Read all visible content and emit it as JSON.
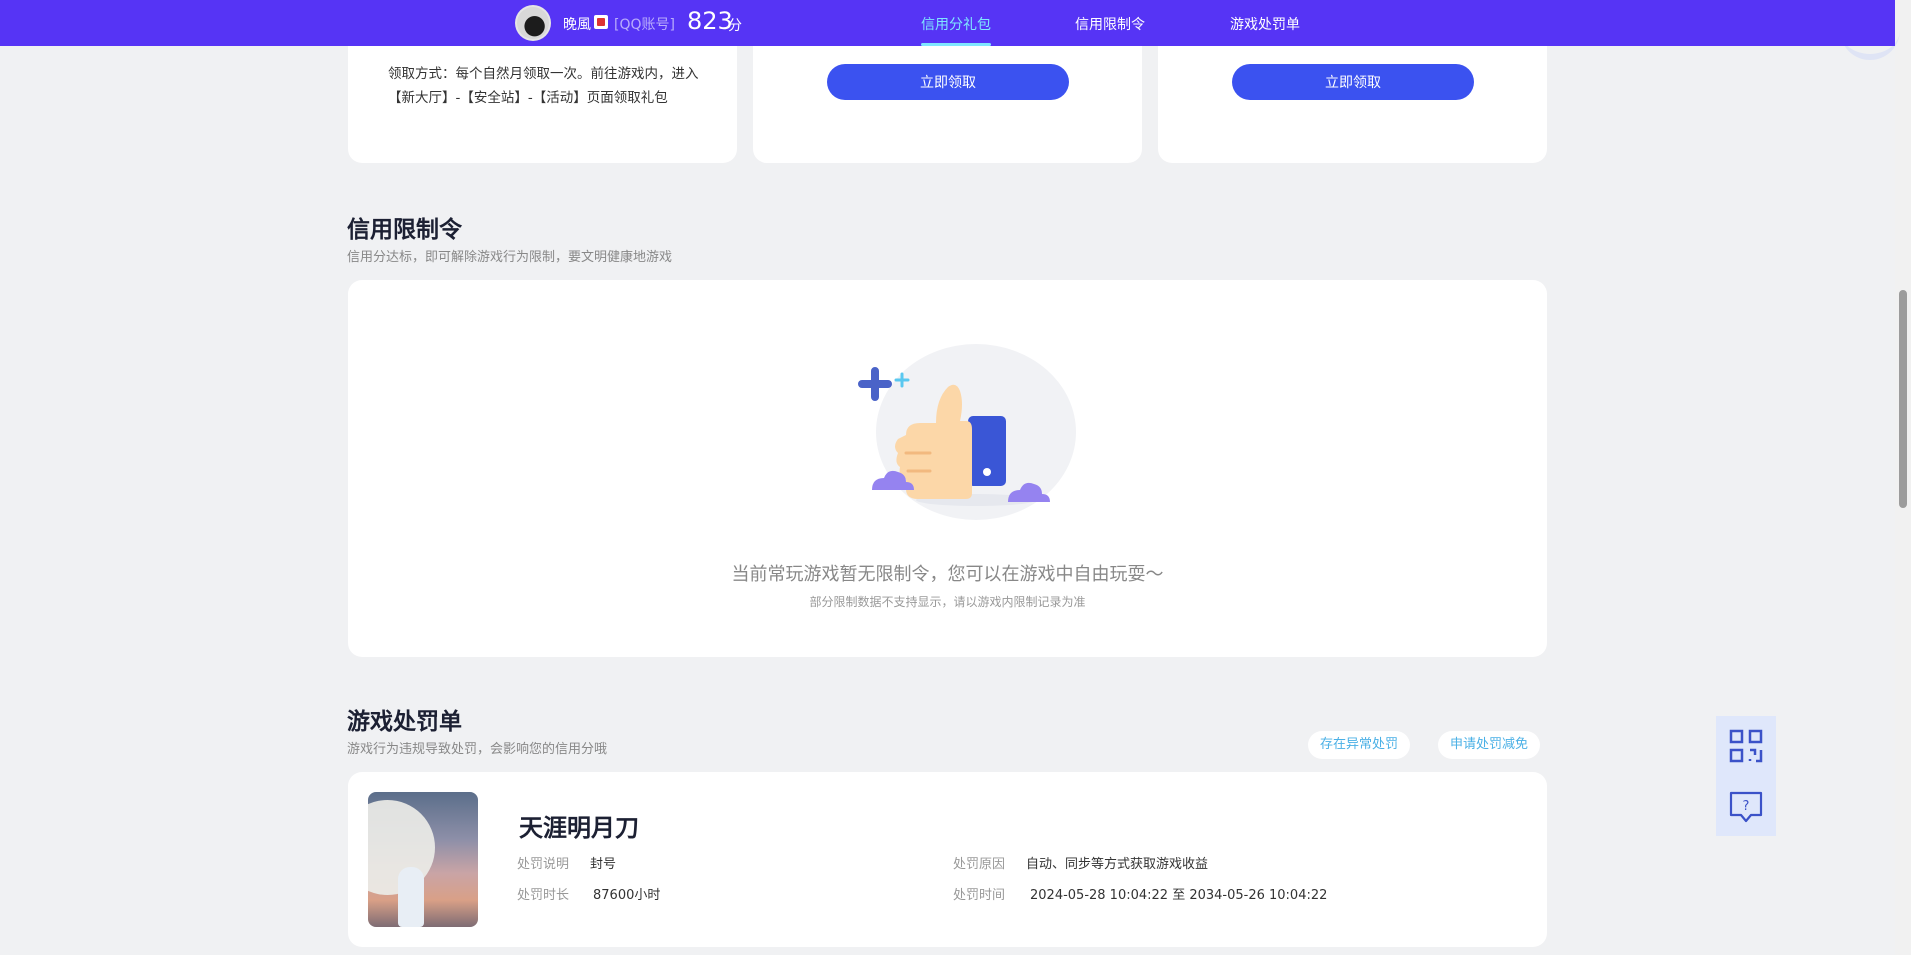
{
  "header": {
    "nickname": "晚風",
    "account_type": "[QQ账号]",
    "score": "823",
    "score_unit": "分",
    "nav": [
      "信用分礼包",
      "信用限制令",
      "游戏处罚单"
    ],
    "active_tab": "信用分礼包",
    "bar_color": "#5634f5"
  },
  "gift": {
    "description": "领取方式：每个自然月领取一次。前往游戏内，进入【新大厅】-【安全站】-【活动】页面领取礼包",
    "claim_label": "立即领取"
  },
  "restriction": {
    "title": "信用限制令",
    "subtitle": "信用分达标，即可解除游戏行为限制，要文明健康地游戏",
    "empty_main": "当前常玩游戏暂无限制令，您可以在游戏中自由玩耍～",
    "empty_sub": "部分限制数据不支持显示，请以游戏内限制记录为准"
  },
  "penalty": {
    "title": "游戏处罚单",
    "subtitle": "游戏行为违规导致处罚，会影响您的信用分哦",
    "report_label": "存在异常处罚",
    "appeal_label": "申请处罚减免",
    "game_name": "天涯明月刀",
    "desc_label": "处罚说明",
    "desc_value": "封号",
    "duration_label": "处罚时长",
    "duration_value": "87600小时",
    "reason_label": "处罚原因",
    "reason_value": "自动、同步等方式获取游戏收益",
    "time_label": "处罚时间",
    "time_value": "2024-05-28 10:04:22 至 2034-05-26 10:04:22"
  },
  "icons": [
    "qr-code-icon",
    "help-chat-icon",
    "thumbs-up-illustration"
  ],
  "accent_color": "#3b52f0"
}
